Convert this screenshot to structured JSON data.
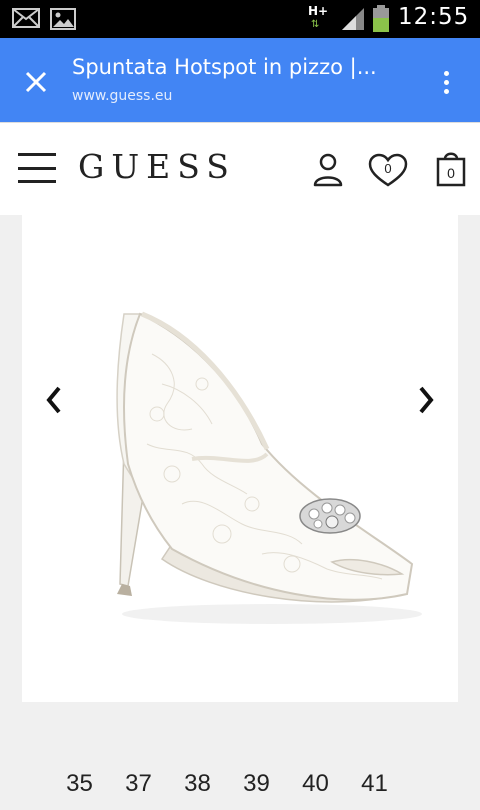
{
  "status_bar": {
    "network_type": "H+",
    "time": "12:55",
    "icons": [
      "mail-icon",
      "gallery-icon",
      "network-icon",
      "signal-icon",
      "battery-icon"
    ],
    "battery_color": "#8bc34a"
  },
  "browser": {
    "title": "Spuntata Hotspot in pizzo |...",
    "url": "www.guess.eu",
    "bar_color": "#4285f4"
  },
  "header": {
    "logo": "GUESS",
    "wishlist_count": "0",
    "cart_count": "0"
  },
  "product": {
    "image": "white-lace-peep-toe-pump",
    "sizes": [
      "35",
      "37",
      "38",
      "39",
      "40",
      "41"
    ]
  }
}
